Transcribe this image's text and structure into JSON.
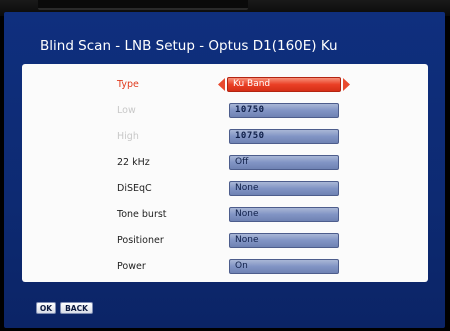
{
  "header": {
    "title": "Blind Scan - LNB Setup - Optus D1(160E) Ku"
  },
  "rows": [
    {
      "label": "Type",
      "value": "Ku Band"
    },
    {
      "label": "Low",
      "value": "10750"
    },
    {
      "label": "High",
      "value": "10750"
    },
    {
      "label": "22 kHz",
      "value": "Off"
    },
    {
      "label": "DiSEqC",
      "value": "None"
    },
    {
      "label": "Tone burst",
      "value": "None"
    },
    {
      "label": "Positioner",
      "value": "None"
    },
    {
      "label": "Power",
      "value": "On"
    }
  ],
  "footer": {
    "ok_label": "OK",
    "back_label": "BACK"
  },
  "colors": {
    "background": "#0f2f7e",
    "selected": "#ea3f25",
    "field": "#8194c4",
    "panel": "#fbfbfb"
  },
  "icons": {
    "left": "arrow-left-icon",
    "right": "arrow-right-icon"
  }
}
